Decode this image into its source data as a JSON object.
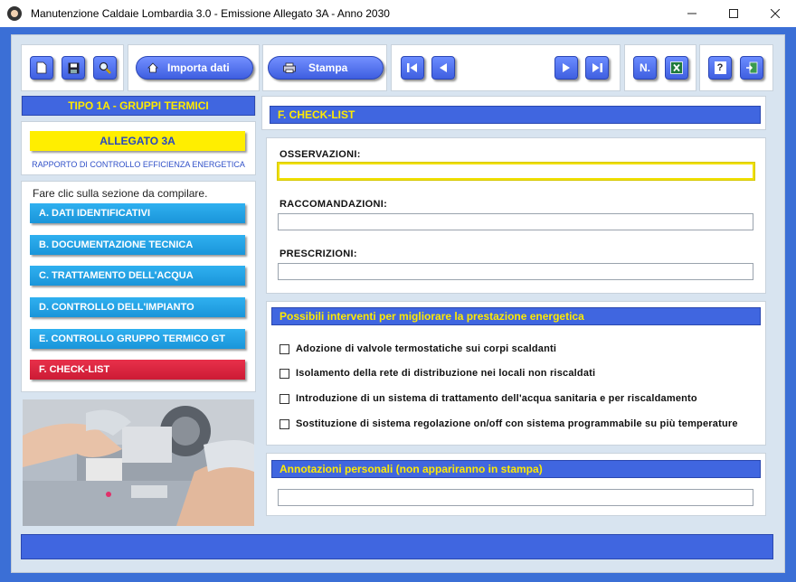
{
  "window": {
    "title": "Manutenzione Caldaie Lombardia 3.0 - Emissione Allegato 3A - Anno 2030",
    "minimize_icon": "minimize-icon",
    "maximize_icon": "maximize-icon",
    "close_icon": "close-icon"
  },
  "toolbar": {
    "new_icon": "new-document-icon",
    "save_icon": "save-icon",
    "search_icon": "search-icon",
    "import_label": "Importa dati",
    "print_label": "Stampa",
    "first_icon": "first-record-icon",
    "prev_icon": "previous-record-icon",
    "next_icon": "next-record-icon",
    "last_icon": "last-record-icon",
    "number_label": "N.",
    "excel_icon": "excel-icon",
    "help_label": "?",
    "exit_icon": "exit-icon"
  },
  "left": {
    "tipo_header": "TIPO 1A - GRUPPI TERMICI",
    "allegato_label": "ALLEGATO 3A",
    "rapporto_label": "RAPPORTO DI CONTROLLO EFFICIENZA ENERGETICA",
    "hint": "Fare clic sulla sezione da compilare.",
    "sections": [
      "A. DATI IDENTIFICATIVI",
      "B. DOCUMENTAZIONE TECNICA",
      "C. TRATTAMENTO DELL'ACQUA",
      "D. CONTROLLO DELL'IMPIANTO",
      "E. CONTROLLO GRUPPO TERMICO GT",
      "F. CHECK-LIST"
    ],
    "active_section": "F. CHECK-LIST"
  },
  "main": {
    "section_title": "F. CHECK-LIST",
    "osservazioni_label": "OSSERVAZIONI:",
    "osservazioni_value": "",
    "raccomandazioni_label": "RACCOMANDAZIONI:",
    "raccomandazioni_value": "",
    "prescrizioni_label": "PRESCRIZIONI:",
    "prescrizioni_value": "",
    "interventi_title": "Possibili interventi per migliorare la prestazione energetica",
    "interventi": [
      "Adozione di valvole termostatiche sui corpi scaldanti",
      "Isolamento della rete di distribuzione nei locali non riscaldati",
      "Introduzione di un sistema di trattamento dell'acqua sanitaria e per riscaldamento",
      "Sostituzione di sistema regolazione on/off con sistema programmabile su più temperature"
    ],
    "interventi_checked": [
      false,
      false,
      false,
      false
    ],
    "annotazioni_title": "Annotazioni personali (non appariranno in stampa)",
    "annotazioni_value": ""
  },
  "colors": {
    "accent_blue": "#4066e0",
    "header_text_yellow": "#ffea00",
    "section_button_cyan": "#1a95da",
    "active_section_red": "#cc1b35",
    "focus_yellow": "#f0e000"
  }
}
